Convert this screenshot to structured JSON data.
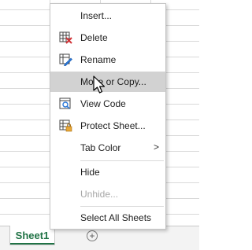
{
  "sheet_tabs": {
    "active_tab_label": "Sheet1",
    "add_sheet_glyph": "+"
  },
  "context_menu": {
    "items": [
      {
        "label": "Insert...",
        "icon": "none",
        "state": "normal"
      },
      {
        "label": "Delete",
        "icon": "delete-sheet-icon",
        "state": "normal"
      },
      {
        "label": "Rename",
        "icon": "rename-sheet-icon",
        "state": "normal"
      },
      {
        "label": "Move or Copy...",
        "icon": "none",
        "state": "hover"
      },
      {
        "label": "View Code",
        "icon": "view-code-icon",
        "state": "normal"
      },
      {
        "label": "Protect Sheet...",
        "icon": "protect-sheet-icon",
        "state": "normal"
      },
      {
        "label": "Tab Color",
        "icon": "none",
        "state": "normal",
        "submenu_arrow": ">"
      },
      {
        "label": "Hide",
        "icon": "none",
        "state": "normal"
      },
      {
        "label": "Unhide...",
        "icon": "none",
        "state": "disabled"
      },
      {
        "label": "Select All Sheets",
        "icon": "none",
        "state": "normal"
      }
    ]
  },
  "colors": {
    "excel_green": "#217346",
    "hover_bg": "#d2d2d2",
    "disabled_text": "#a6a6a6"
  }
}
